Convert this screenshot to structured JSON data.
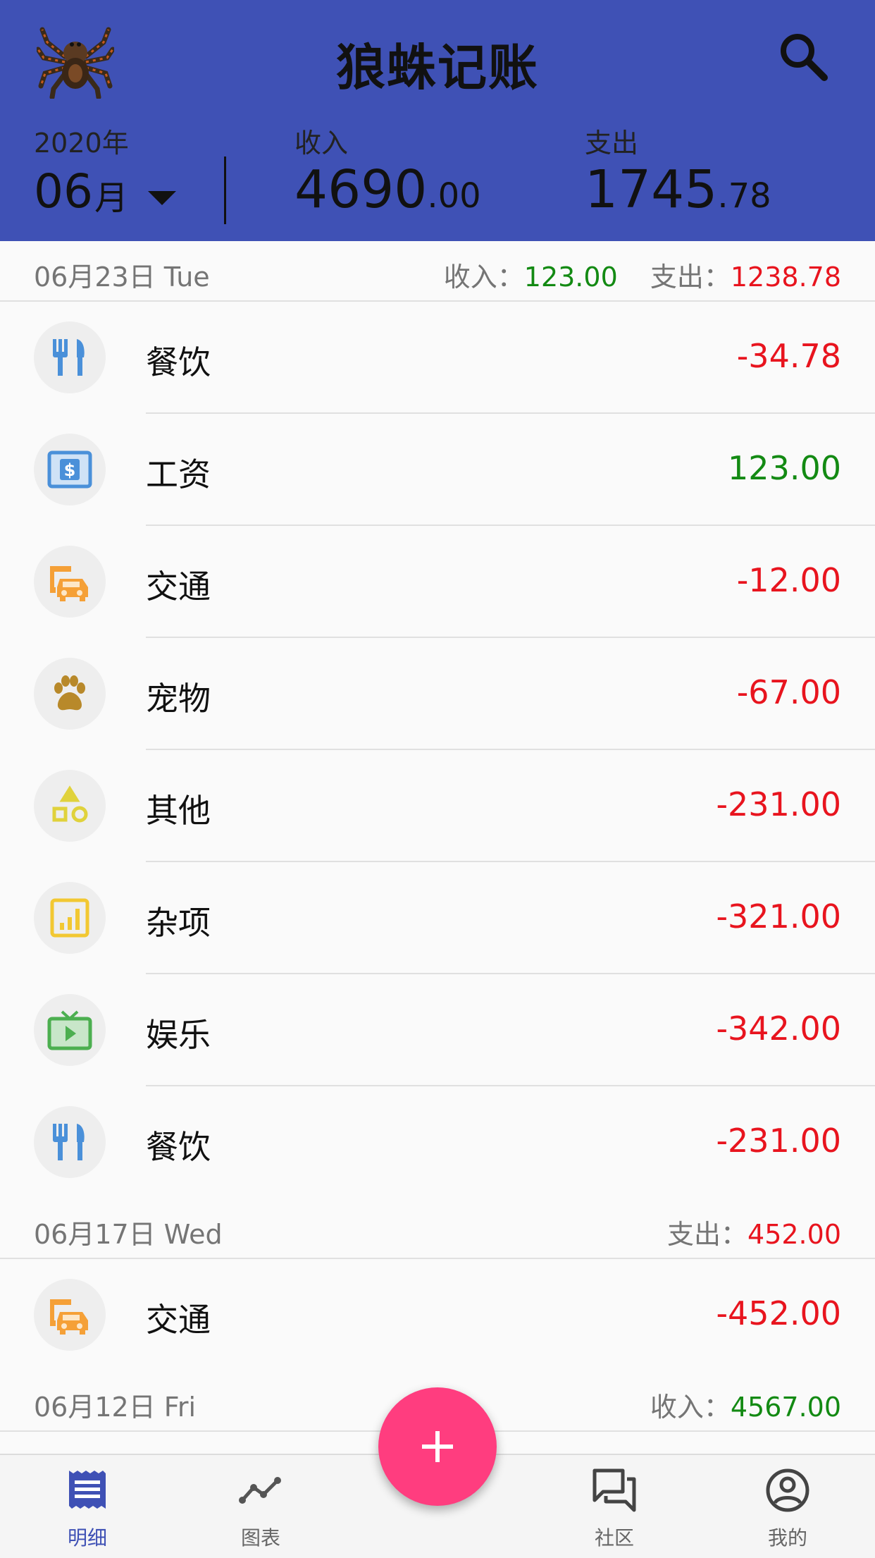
{
  "colors": {
    "header_bg": "#3f51b5",
    "income": "#138a13",
    "expense": "#e8141e",
    "fab": "#ff3d7f"
  },
  "header": {
    "title": "狼蛛记账",
    "year": "2020年",
    "month": "06",
    "month_unit": "月",
    "income_label": "收入",
    "income_int": "4690",
    "income_dec": ".00",
    "expense_label": "支出",
    "expense_int": "1745",
    "expense_dec": ".78"
  },
  "days": [
    {
      "date": "06月23日 Tue",
      "income_label": "收入：",
      "income": "123.00",
      "expense_label": "支出：",
      "expense": "1238.78",
      "items": [
        {
          "category": "餐饮",
          "amount": "-34.78",
          "icon": "fork-knife-icon"
        },
        {
          "category": "工资",
          "amount": "123.00",
          "icon": "dollar-bill-icon"
        },
        {
          "category": "交通",
          "amount": "-12.00",
          "icon": "bus-car-icon"
        },
        {
          "category": "宠物",
          "amount": "-67.00",
          "icon": "paw-icon"
        },
        {
          "category": "其他",
          "amount": "-231.00",
          "icon": "shapes-icon"
        },
        {
          "category": "杂项",
          "amount": "-321.00",
          "icon": "bar-chart-icon"
        },
        {
          "category": "娱乐",
          "amount": "-342.00",
          "icon": "tv-icon"
        },
        {
          "category": "餐饮",
          "amount": "-231.00",
          "icon": "fork-knife-icon"
        }
      ]
    },
    {
      "date": "06月17日 Wed",
      "expense_label": "支出：",
      "expense": "452.00",
      "items": [
        {
          "category": "交通",
          "amount": "-452.00",
          "icon": "bus-car-icon"
        }
      ]
    },
    {
      "date": "06月12日 Fri",
      "income_label": "收入：",
      "income": "4567.00"
    }
  ],
  "nav": [
    {
      "label": "明细",
      "icon": "receipt-icon"
    },
    {
      "label": "图表",
      "icon": "trend-line-icon"
    },
    {
      "label": "社区",
      "icon": "chat-icon"
    },
    {
      "label": "我的",
      "icon": "account-icon"
    }
  ],
  "fab_label": "+"
}
